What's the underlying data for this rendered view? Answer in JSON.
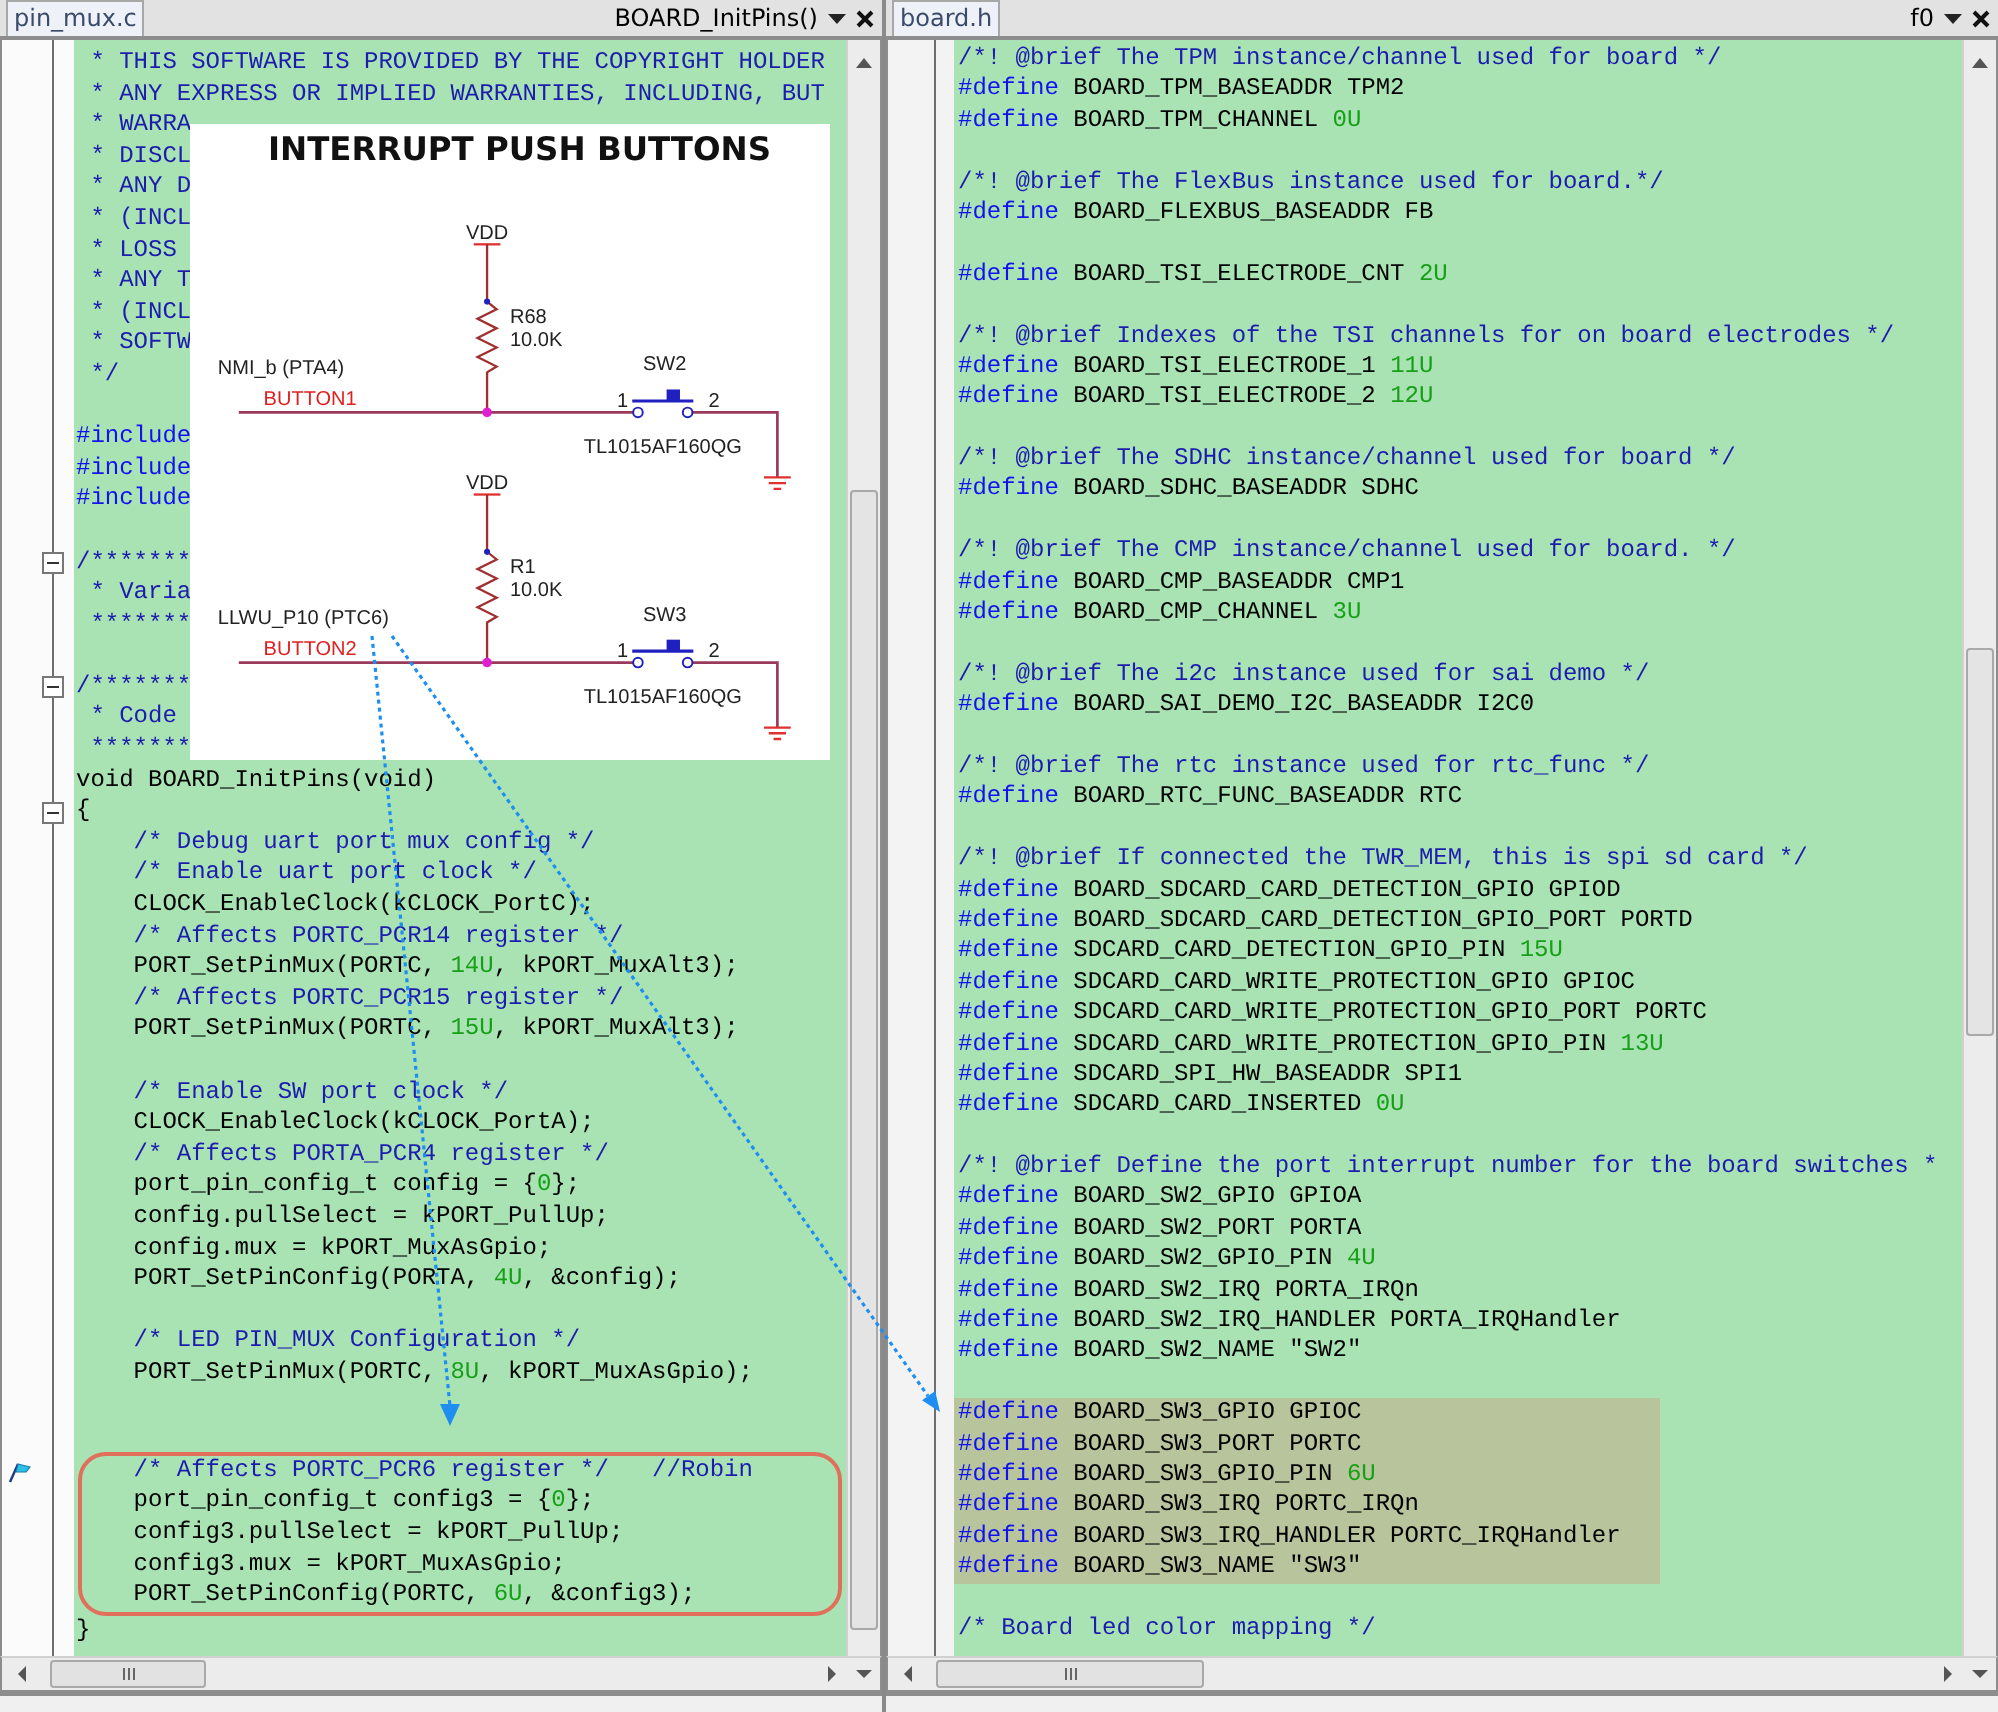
{
  "left": {
    "tabs": [
      {
        "label": "pin_mux.c",
        "selected": true
      }
    ],
    "function_selector": "BOARD_InitPins()",
    "lines": [
      {
        "fold": false,
        "tokens": [
          {
            "kind": "comment",
            "text": " * THIS SOFTWARE IS PROVIDED BY THE COPYRIGHT HOLDER"
          }
        ]
      },
      {
        "fold": false,
        "tokens": [
          {
            "kind": "comment",
            "text": " * ANY EXPRESS OR IMPLIED WARRANTIES, INCLUDING, BUT"
          }
        ]
      },
      {
        "fold": false,
        "tokens": [
          {
            "kind": "comment",
            "text": " * WARRA"
          }
        ]
      },
      {
        "fold": false,
        "tokens": [
          {
            "kind": "comment",
            "text": " * DISCL"
          }
        ]
      },
      {
        "fold": false,
        "tokens": [
          {
            "kind": "comment",
            "text": " * ANY D"
          }
        ]
      },
      {
        "fold": false,
        "tokens": [
          {
            "kind": "comment",
            "text": " * (INCL"
          }
        ]
      },
      {
        "fold": false,
        "tokens": [
          {
            "kind": "comment",
            "text": " * LOSS"
          }
        ]
      },
      {
        "fold": false,
        "tokens": [
          {
            "kind": "comment",
            "text": " * ANY T"
          }
        ]
      },
      {
        "fold": false,
        "tokens": [
          {
            "kind": "comment",
            "text": " * (INCL"
          }
        ]
      },
      {
        "fold": false,
        "tokens": [
          {
            "kind": "comment",
            "text": " * SOFTW"
          }
        ]
      },
      {
        "fold": false,
        "tokens": [
          {
            "kind": "comment",
            "text": " */"
          }
        ]
      },
      {
        "fold": false
      },
      {
        "fold": false,
        "tokens": [
          {
            "kind": "directive",
            "text": "#include"
          }
        ]
      },
      {
        "fold": false,
        "tokens": [
          {
            "kind": "directive",
            "text": "#include"
          }
        ]
      },
      {
        "fold": false,
        "tokens": [
          {
            "kind": "directive",
            "text": "#include"
          }
        ]
      },
      {
        "fold": false
      },
      {
        "fold": true,
        "tokens": [
          {
            "kind": "comment",
            "text": "/*******"
          }
        ]
      },
      {
        "fold": false,
        "tokens": [
          {
            "kind": "comment",
            "text": " * Varia"
          }
        ]
      },
      {
        "fold": false,
        "tokens": [
          {
            "kind": "comment",
            "text": " *******"
          }
        ]
      },
      {
        "fold": false
      },
      {
        "fold": true,
        "tokens": [
          {
            "kind": "comment",
            "text": "/*******"
          }
        ]
      },
      {
        "fold": false,
        "tokens": [
          {
            "kind": "comment",
            "text": " * Code"
          }
        ]
      },
      {
        "fold": false,
        "tokens": [
          {
            "kind": "comment",
            "text": " *******"
          }
        ]
      },
      {
        "fold": false,
        "tokens": [
          {
            "kind": "plain",
            "text": "void BOARD_InitPins(void)"
          }
        ]
      },
      {
        "fold": true,
        "tokens": [
          {
            "kind": "plain",
            "text": "{"
          }
        ]
      },
      {
        "fold": false,
        "tokens": [
          {
            "kind": "comment",
            "text": "    /* Debug uart port mux config */"
          }
        ]
      },
      {
        "fold": false,
        "tokens": [
          {
            "kind": "comment",
            "text": "    /* Enable uart port clock */"
          }
        ]
      },
      {
        "fold": false,
        "tokens": [
          {
            "kind": "plain",
            "text": "    CLOCK_EnableClock(kCLOCK_PortC);"
          }
        ]
      },
      {
        "fold": false,
        "tokens": [
          {
            "kind": "comment",
            "text": "    /* Affects PORTC_PCR14 register */"
          }
        ]
      },
      {
        "fold": false,
        "tokens": [
          {
            "kind": "plain",
            "text": "    PORT_SetPinMux(PORTC, "
          },
          {
            "kind": "number",
            "text": "14U"
          },
          {
            "kind": "plain",
            "text": ", kPORT_MuxAlt3);"
          }
        ]
      },
      {
        "fold": false,
        "tokens": [
          {
            "kind": "comment",
            "text": "    /* Affects PORTC_PCR15 register */"
          }
        ]
      },
      {
        "fold": false,
        "tokens": [
          {
            "kind": "plain",
            "text": "    PORT_SetPinMux(PORTC, "
          },
          {
            "kind": "number",
            "text": "15U"
          },
          {
            "kind": "plain",
            "text": ", kPORT_MuxAlt3);"
          }
        ]
      },
      {
        "fold": false
      },
      {
        "fold": false,
        "tokens": [
          {
            "kind": "comment",
            "text": "    /* Enable SW port clock */"
          }
        ]
      },
      {
        "fold": false,
        "tokens": [
          {
            "kind": "plain",
            "text": "    CLOCK_EnableClock(kCLOCK_PortA);"
          }
        ]
      },
      {
        "fold": false,
        "tokens": [
          {
            "kind": "comment",
            "text": "    /* Affects PORTA_PCR4 register */"
          }
        ]
      },
      {
        "fold": false,
        "tokens": [
          {
            "kind": "plain",
            "text": "    port_pin_config_t config = {"
          },
          {
            "kind": "number",
            "text": "0"
          },
          {
            "kind": "plain",
            "text": "};"
          }
        ]
      },
      {
        "fold": false,
        "tokens": [
          {
            "kind": "plain",
            "text": "    config.pullSelect = kPORT_PullUp;"
          }
        ]
      },
      {
        "fold": false,
        "tokens": [
          {
            "kind": "plain",
            "text": "    config.mux = kPORT_MuxAsGpio;"
          }
        ]
      },
      {
        "fold": false,
        "tokens": [
          {
            "kind": "plain",
            "text": "    PORT_SetPinConfig(PORTA, "
          },
          {
            "kind": "number",
            "text": "4U"
          },
          {
            "kind": "plain",
            "text": ", &config);"
          }
        ]
      },
      {
        "fold": false
      },
      {
        "fold": false,
        "tokens": [
          {
            "kind": "comment",
            "text": "    /* LED PIN_MUX Configuration */"
          }
        ]
      },
      {
        "fold": false,
        "tokens": [
          {
            "kind": "plain",
            "text": "    PORT_SetPinMux(PORTC, "
          },
          {
            "kind": "number",
            "text": "8U"
          },
          {
            "kind": "plain",
            "text": ", kPORT_MuxAsGpio);"
          }
        ]
      },
      {
        "fold": false
      },
      {
        "fold": false
      }
    ],
    "callout": {
      "lines": [
        {
          "bookmark": true,
          "tokens": [
            {
              "kind": "comment",
              "text": "    /* Affects PORTC_PCR6 register */   //Robin"
            }
          ]
        },
        {
          "bookmark": false,
          "tokens": [
            {
              "kind": "plain",
              "text": "    port_pin_config_t config3 = {"
            },
            {
              "kind": "number",
              "text": "0"
            },
            {
              "kind": "plain",
              "text": "};"
            }
          ]
        },
        {
          "bookmark": false,
          "tokens": [
            {
              "kind": "plain",
              "text": "    config3.pullSelect = kPORT_PullUp;"
            }
          ]
        },
        {
          "bookmark": false,
          "tokens": [
            {
              "kind": "plain",
              "text": "    config3.mux = kPORT_MuxAsGpio;"
            }
          ]
        },
        {
          "bookmark": false,
          "tokens": [
            {
              "kind": "plain",
              "text": "    PORT_SetPinConfig(PORTC, "
            },
            {
              "kind": "number",
              "text": "6U"
            },
            {
              "kind": "plain",
              "text": ", &config3);"
            }
          ]
        }
      ]
    },
    "lines_after": [
      {
        "fold": false,
        "tokens": [
          {
            "kind": "plain",
            "text": "}"
          }
        ]
      }
    ]
  },
  "right": {
    "tabs": [
      {
        "label": "board.h",
        "selected": true
      }
    ],
    "function_selector": "f0",
    "lines": [
      {
        "tokens": [
          {
            "kind": "comment",
            "text": "/*! @brief The TPM instance/channel used for board */"
          }
        ]
      },
      {
        "tokens": [
          {
            "kind": "directive",
            "text": "#define"
          },
          {
            "kind": "plain",
            "text": " BOARD_TPM_BASEADDR TPM2"
          }
        ]
      },
      {
        "tokens": [
          {
            "kind": "directive",
            "text": "#define"
          },
          {
            "kind": "plain",
            "text": " BOARD_TPM_CHANNEL "
          },
          {
            "kind": "number",
            "text": "0U"
          }
        ]
      },
      {
        "blank": true
      },
      {
        "tokens": [
          {
            "kind": "comment",
            "text": "/*! @brief The FlexBus instance used for board.*/"
          }
        ]
      },
      {
        "tokens": [
          {
            "kind": "directive",
            "text": "#define"
          },
          {
            "kind": "plain",
            "text": " BOARD_FLEXBUS_BASEADDR FB"
          }
        ]
      },
      {
        "blank": true
      },
      {
        "tokens": [
          {
            "kind": "directive",
            "text": "#define"
          },
          {
            "kind": "plain",
            "text": " BOARD_TSI_ELECTRODE_CNT "
          },
          {
            "kind": "number",
            "text": "2U"
          }
        ]
      },
      {
        "blank": true
      },
      {
        "tokens": [
          {
            "kind": "comment",
            "text": "/*! @brief Indexes of the TSI channels for on board electrodes */"
          }
        ]
      },
      {
        "tokens": [
          {
            "kind": "directive",
            "text": "#define"
          },
          {
            "kind": "plain",
            "text": " BOARD_TSI_ELECTRODE_1 "
          },
          {
            "kind": "number",
            "text": "11U"
          }
        ]
      },
      {
        "tokens": [
          {
            "kind": "directive",
            "text": "#define"
          },
          {
            "kind": "plain",
            "text": " BOARD_TSI_ELECTRODE_2 "
          },
          {
            "kind": "number",
            "text": "12U"
          }
        ]
      },
      {
        "blank": true
      },
      {
        "tokens": [
          {
            "kind": "comment",
            "text": "/*! @brief The SDHC instance/channel used for board */"
          }
        ]
      },
      {
        "tokens": [
          {
            "kind": "directive",
            "text": "#define"
          },
          {
            "kind": "plain",
            "text": " BOARD_SDHC_BASEADDR SDHC"
          }
        ]
      },
      {
        "blank": true
      },
      {
        "tokens": [
          {
            "kind": "comment",
            "text": "/*! @brief The CMP instance/channel used for board. */"
          }
        ]
      },
      {
        "tokens": [
          {
            "kind": "directive",
            "text": "#define"
          },
          {
            "kind": "plain",
            "text": " BOARD_CMP_BASEADDR CMP1"
          }
        ]
      },
      {
        "tokens": [
          {
            "kind": "directive",
            "text": "#define"
          },
          {
            "kind": "plain",
            "text": " BOARD_CMP_CHANNEL "
          },
          {
            "kind": "number",
            "text": "3U"
          }
        ]
      },
      {
        "blank": true
      },
      {
        "tokens": [
          {
            "kind": "comment",
            "text": "/*! @brief The i2c instance used for sai demo */"
          }
        ]
      },
      {
        "tokens": [
          {
            "kind": "directive",
            "text": "#define"
          },
          {
            "kind": "plain",
            "text": " BOARD_SAI_DEMO_I2C_BASEADDR I2C0"
          }
        ]
      },
      {
        "blank": true
      },
      {
        "tokens": [
          {
            "kind": "comment",
            "text": "/*! @brief The rtc instance used for rtc_func */"
          }
        ]
      },
      {
        "tokens": [
          {
            "kind": "directive",
            "text": "#define"
          },
          {
            "kind": "plain",
            "text": " BOARD_RTC_FUNC_BASEADDR RTC"
          }
        ]
      },
      {
        "blank": true
      },
      {
        "tokens": [
          {
            "kind": "comment",
            "text": "/*! @brief If connected the TWR_MEM, this is spi sd card */"
          }
        ]
      },
      {
        "tokens": [
          {
            "kind": "directive",
            "text": "#define"
          },
          {
            "kind": "plain",
            "text": " BOARD_SDCARD_CARD_DETECTION_GPIO GPIOD"
          }
        ]
      },
      {
        "tokens": [
          {
            "kind": "directive",
            "text": "#define"
          },
          {
            "kind": "plain",
            "text": " BOARD_SDCARD_CARD_DETECTION_GPIO_PORT PORTD"
          }
        ]
      },
      {
        "tokens": [
          {
            "kind": "directive",
            "text": "#define"
          },
          {
            "kind": "plain",
            "text": " SDCARD_CARD_DETECTION_GPIO_PIN "
          },
          {
            "kind": "number",
            "text": "15U"
          }
        ]
      },
      {
        "tokens": [
          {
            "kind": "directive",
            "text": "#define"
          },
          {
            "kind": "plain",
            "text": " SDCARD_CARD_WRITE_PROTECTION_GPIO GPIOC"
          }
        ]
      },
      {
        "tokens": [
          {
            "kind": "directive",
            "text": "#define"
          },
          {
            "kind": "plain",
            "text": " SDCARD_CARD_WRITE_PROTECTION_GPIO_PORT PORTC"
          }
        ]
      },
      {
        "tokens": [
          {
            "kind": "directive",
            "text": "#define"
          },
          {
            "kind": "plain",
            "text": " SDCARD_CARD_WRITE_PROTECTION_GPIO_PIN "
          },
          {
            "kind": "number",
            "text": "13U"
          }
        ]
      },
      {
        "tokens": [
          {
            "kind": "directive",
            "text": "#define"
          },
          {
            "kind": "plain",
            "text": " SDCARD_SPI_HW_BASEADDR SPI1"
          }
        ]
      },
      {
        "tokens": [
          {
            "kind": "directive",
            "text": "#define"
          },
          {
            "kind": "plain",
            "text": " SDCARD_CARD_INSERTED "
          },
          {
            "kind": "number",
            "text": "0U"
          }
        ]
      },
      {
        "blank": true
      },
      {
        "tokens": [
          {
            "kind": "comment",
            "text": "/*! @brief Define the port interrupt number for the board switches *"
          }
        ]
      },
      {
        "tokens": [
          {
            "kind": "directive",
            "text": "#define"
          },
          {
            "kind": "plain",
            "text": " BOARD_SW2_GPIO GPIOA"
          }
        ]
      },
      {
        "tokens": [
          {
            "kind": "directive",
            "text": "#define"
          },
          {
            "kind": "plain",
            "text": " BOARD_SW2_PORT PORTA"
          }
        ]
      },
      {
        "tokens": [
          {
            "kind": "directive",
            "text": "#define"
          },
          {
            "kind": "plain",
            "text": " BOARD_SW2_GPIO_PIN "
          },
          {
            "kind": "number",
            "text": "4U"
          }
        ]
      },
      {
        "tokens": [
          {
            "kind": "directive",
            "text": "#define"
          },
          {
            "kind": "plain",
            "text": " BOARD_SW2_IRQ PORTA_IRQn"
          }
        ]
      },
      {
        "tokens": [
          {
            "kind": "directive",
            "text": "#define"
          },
          {
            "kind": "plain",
            "text": " BOARD_SW2_IRQ_HANDLER PORTA_IRQHandler"
          }
        ]
      },
      {
        "tokens": [
          {
            "kind": "directive",
            "text": "#define"
          },
          {
            "kind": "plain",
            "text": " BOARD_SW2_NAME \"SW2\""
          }
        ]
      },
      {
        "blank": true
      }
    ],
    "highlighted_block": {
      "lines": [
        {
          "tokens": [
            {
              "kind": "directive",
              "text": "#define"
            },
            {
              "kind": "plain",
              "text": " BOARD_SW3_GPIO GPIOC"
            }
          ]
        },
        {
          "tokens": [
            {
              "kind": "directive",
              "text": "#define"
            },
            {
              "kind": "plain",
              "text": " BOARD_SW3_PORT PORTC"
            }
          ]
        },
        {
          "tokens": [
            {
              "kind": "directive",
              "text": "#define"
            },
            {
              "kind": "plain",
              "text": " BOARD_SW3_GPIO_PIN "
            },
            {
              "kind": "number",
              "text": "6U"
            }
          ]
        },
        {
          "tokens": [
            {
              "kind": "directive",
              "text": "#define"
            },
            {
              "kind": "plain",
              "text": " BOARD_SW3_IRQ PORTC_IRQn"
            }
          ]
        },
        {
          "tokens": [
            {
              "kind": "directive",
              "text": "#define"
            },
            {
              "kind": "plain",
              "text": " BOARD_SW3_IRQ_HANDLER PORTC_IRQHandler"
            }
          ]
        },
        {
          "tokens": [
            {
              "kind": "directive",
              "text": "#define"
            },
            {
              "kind": "plain",
              "text": " BOARD_SW3_NAME \"SW3\""
            }
          ]
        }
      ]
    },
    "lines_after": [
      {
        "blank": true
      },
      {
        "tokens": [
          {
            "kind": "comment",
            "text": "/* Board led color mapping */"
          }
        ]
      }
    ]
  },
  "schematic": {
    "title": "INTERRUPT PUSH BUTTONS",
    "circuits": [
      {
        "supply": "VDD",
        "resistor": "R68",
        "resistor_value": "10.0K",
        "signal": "NMI_b (PTA4)",
        "net": "BUTTON1",
        "switch": "SW2",
        "pin_1": "1",
        "pin_2": "2",
        "part": "TL1015AF160QG"
      },
      {
        "supply": "VDD",
        "resistor": "R1",
        "resistor_value": "10.0K",
        "signal": "LLWU_P10 (PTC6)",
        "net": "BUTTON2",
        "switch": "SW3",
        "pin_1": "1",
        "pin_2": "2",
        "part": "TL1015AF160QG"
      }
    ]
  }
}
